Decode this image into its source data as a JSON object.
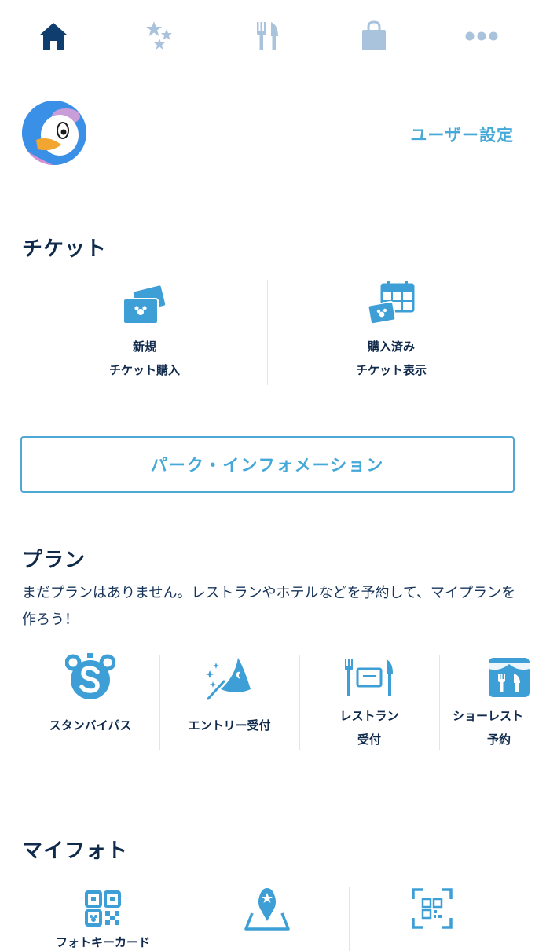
{
  "nav": {
    "items": [
      {
        "name": "home",
        "icon": "home-icon",
        "active": true
      },
      {
        "name": "entertainment",
        "icon": "stars-icon",
        "active": false
      },
      {
        "name": "restaurant",
        "icon": "fork-knife-icon",
        "active": false
      },
      {
        "name": "shopping",
        "icon": "shopping-bag-icon",
        "active": false
      },
      {
        "name": "more",
        "icon": "more-dots-icon",
        "active": false
      }
    ],
    "active_color": "#0f3d6e",
    "inactive_color": "#a9c3dd"
  },
  "profile": {
    "avatar_icon": "avatar-daisy-duck",
    "settings_label": "ユーザー設定"
  },
  "tickets": {
    "title": "チケット",
    "items": [
      {
        "line1": "新規",
        "line2": "チケット購入",
        "icon": "ticket-purchase-icon"
      },
      {
        "line1": "購入済み",
        "line2": "チケット表示",
        "icon": "ticket-calendar-icon"
      }
    ]
  },
  "park_info": {
    "label": "パーク・インフォメーション"
  },
  "plan": {
    "title": "プラン",
    "description": "まだプランはありません。レストランやホテルなどを予約して、マイプランを作ろう！",
    "items": [
      {
        "line1": "スタンバイパス",
        "line2": "",
        "icon": "standby-pass-icon"
      },
      {
        "line1": "エントリー受付",
        "line2": "",
        "icon": "wizard-hat-icon"
      },
      {
        "line1": "レストラン",
        "line2": "受付",
        "icon": "restaurant-icon"
      },
      {
        "line1": "ショーレスト",
        "line2": "予約",
        "icon": "show-restaurant-icon"
      }
    ]
  },
  "myphoto": {
    "title": "マイフォト",
    "items": [
      {
        "label": "フォトキーカード",
        "icon": "qr-code-icon"
      },
      {
        "label": "",
        "icon": "map-pin-icon"
      },
      {
        "label": "",
        "icon": "qr-scan-icon"
      }
    ]
  },
  "colors": {
    "accent": "#44a8d8",
    "icon_blue": "#3d9fd6",
    "heading": "#102a4c",
    "divider": "#e4e4e4"
  }
}
